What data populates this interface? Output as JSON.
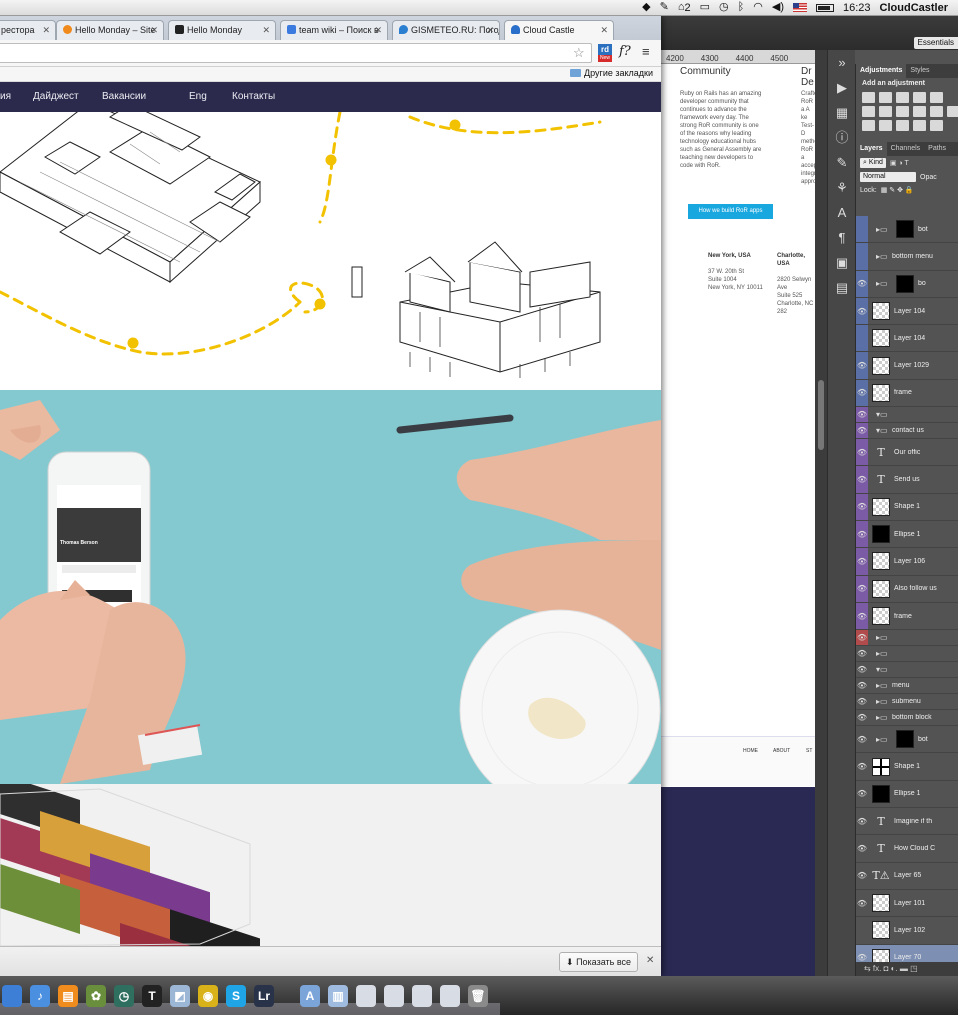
{
  "menubar": {
    "adobe_badge": "2",
    "clock": "16:23",
    "user": "CloudCastler"
  },
  "browser": {
    "tabs": [
      {
        "label": "рестора",
        "favicon_color": "#e07b2a"
      },
      {
        "label": "Hello Monday – Site",
        "favicon_color": "#f08a1c"
      },
      {
        "label": "Hello Monday",
        "favicon_color": "#222222"
      },
      {
        "label": "team wiki – Поиск в",
        "favicon_color": "#3b7be0"
      },
      {
        "label": "GISMETEO.RU: Погод",
        "favicon_color": "#2a7fd0"
      },
      {
        "label": "Cloud Castle",
        "favicon_color": "#2a6fc9"
      }
    ],
    "extension_label": "New",
    "extension_letters": "rd",
    "ext2_label": "f?",
    "bookmarks_other": "Другие закладки",
    "show_all": "Показать все",
    "download_arrow": "⬇"
  },
  "site": {
    "nav": [
      "ия",
      "Дайджест",
      "Вакансии",
      "Eng",
      "Контакты"
    ],
    "phone_name": "Thomas Berson"
  },
  "photoshop": {
    "essentials": "Essentials",
    "ruler": [
      "4200",
      "4300",
      "4400",
      "4500"
    ],
    "doc": {
      "heading_left": "Community",
      "heading_right": "De",
      "heading_right_top": "Dr",
      "paragraph": "Ruby on Rails has an amazing developer community that continues to advance the framework every day. The strong RoR community is one of the reasons why leading technology educational hubs such as General Assembly are teaching new developers to code with RoR.",
      "paragraph_right": "Crafte RoR a A ke Test-D metho RoR a accep integra appro",
      "cta": "How we build RoR apps",
      "addr1_title": "New York, USA",
      "addr1_lines": [
        "37 W. 20th St",
        "Suite 1004",
        "New York, NY 10011"
      ],
      "addr2_title": "Charlotte, USA",
      "addr2_lines": [
        "2820 Selwyn Ave",
        "Suite 525",
        "Charlotte, NC 282"
      ],
      "footer_nav": [
        "HOME",
        "ABOUT",
        "ST"
      ]
    },
    "panel_tabs_top": [
      "Adjustments",
      "Styles"
    ],
    "add_adjustment": "Add an adjustment",
    "panel_tabs_layers": [
      "Layers",
      "Channels",
      "Paths"
    ],
    "kind": "Kind",
    "blend": "Normal",
    "opacity_label": "Opac",
    "lock_label": "Lock:",
    "layers": [
      {
        "name": "bot",
        "kind": "folder-mask",
        "eye": "",
        "color": "blue"
      },
      {
        "name": "bottom menu",
        "kind": "folder",
        "eye": "",
        "color": "blue"
      },
      {
        "name": "bo",
        "kind": "folder-mask",
        "eye": "👁",
        "color": "blue"
      },
      {
        "name": "Layer 104",
        "kind": "image",
        "eye": "👁",
        "color": "blue"
      },
      {
        "name": "Layer 104",
        "kind": "image",
        "eye": "",
        "color": "blue"
      },
      {
        "name": "Layer 1029",
        "kind": "image",
        "eye": "👁",
        "color": "blue"
      },
      {
        "name": "frame",
        "kind": "image",
        "eye": "👁",
        "color": "blue"
      },
      {
        "name": "",
        "kind": "folder-open",
        "eye": "👁",
        "color": "purple",
        "tiny": true
      },
      {
        "name": "contact us",
        "kind": "folder-open",
        "eye": "👁",
        "color": "purple",
        "tiny": true
      },
      {
        "name": "Our offic",
        "kind": "text",
        "eye": "👁",
        "color": "purple"
      },
      {
        "name": "Send us",
        "kind": "text",
        "eye": "👁",
        "color": "purple"
      },
      {
        "name": "Shape 1",
        "kind": "image",
        "eye": "👁",
        "color": "purple"
      },
      {
        "name": "Ellipse 1",
        "kind": "black",
        "eye": "👁",
        "color": "purple"
      },
      {
        "name": "Layer 106",
        "kind": "image",
        "eye": "👁",
        "color": "purple"
      },
      {
        "name": "Also follow us",
        "kind": "image",
        "eye": "👁",
        "color": "purple"
      },
      {
        "name": "frame",
        "kind": "image",
        "eye": "👁",
        "color": "purple"
      },
      {
        "name": "",
        "kind": "folder",
        "eye": "👁",
        "color": "red",
        "tiny": true
      },
      {
        "name": "",
        "kind": "folder",
        "eye": "👁",
        "color": "",
        "tiny": true
      },
      {
        "name": "",
        "kind": "folder-open",
        "eye": "👁",
        "color": "",
        "tiny": true
      },
      {
        "name": "menu",
        "kind": "folder",
        "eye": "👁",
        "color": "",
        "tiny": true
      },
      {
        "name": "submenu",
        "kind": "folder",
        "eye": "👁",
        "color": "",
        "tiny": true
      },
      {
        "name": "bottom block",
        "kind": "folder",
        "eye": "👁",
        "color": "",
        "tiny": true
      },
      {
        "name": "bot",
        "kind": "folder-mask",
        "eye": "👁",
        "color": ""
      },
      {
        "name": "Shape 1",
        "kind": "shape",
        "eye": "👁",
        "color": ""
      },
      {
        "name": "Ellipse 1",
        "kind": "black",
        "eye": "👁",
        "color": ""
      },
      {
        "name": "Imagine if th",
        "kind": "text",
        "eye": "👁",
        "color": ""
      },
      {
        "name": "How Cloud C",
        "kind": "text",
        "eye": "👁",
        "color": ""
      },
      {
        "name": "Layer 65",
        "kind": "text-warn",
        "eye": "👁",
        "color": ""
      },
      {
        "name": "Layer 101",
        "kind": "image",
        "eye": "👁",
        "color": ""
      },
      {
        "name": "Layer 102",
        "kind": "image",
        "eye": "",
        "color": ""
      },
      {
        "name": "Layer 70",
        "kind": "image",
        "eye": "👁",
        "color": "",
        "selected": true
      }
    ],
    "panel_footer": "⇆  fx.  ◘  ◐.  ▬  ◳"
  },
  "dock": {
    "icons": [
      {
        "name": "finder",
        "label": "",
        "color": "#3d7fd6"
      },
      {
        "name": "itunes",
        "label": "♪",
        "color": "#4a8fe0"
      },
      {
        "name": "ibooks",
        "label": "▤",
        "color": "#f08b1e"
      },
      {
        "name": "iphoto",
        "label": "✿",
        "color": "#6a8f3c"
      },
      {
        "name": "time-machine",
        "label": "◷",
        "color": "#2f6f5f"
      },
      {
        "name": "typora",
        "label": "T",
        "color": "#222222"
      },
      {
        "name": "preview",
        "label": "◩",
        "color": "#9cb6d6"
      },
      {
        "name": "chrome",
        "label": "◉",
        "color": "#d9b21a"
      },
      {
        "name": "skype",
        "label": "S",
        "color": "#1fa5e6"
      },
      {
        "name": "lightroom",
        "label": "Lr",
        "color": "#28334a"
      },
      {
        "name": "app-folder",
        "label": "A",
        "color": "#7ba4d9"
      },
      {
        "name": "docs-folder",
        "label": "▥",
        "color": "#9fbbe0"
      },
      {
        "name": "screenshot-1",
        "label": "",
        "color": "#d8dce4"
      },
      {
        "name": "screenshot-2",
        "label": "",
        "color": "#d8dce4"
      },
      {
        "name": "screenshot-3",
        "label": "",
        "color": "#d8dce4"
      },
      {
        "name": "screenshot-4",
        "label": "",
        "color": "#d8dce4"
      },
      {
        "name": "trash",
        "label": "🗑",
        "color": "#8a8a8a"
      }
    ]
  }
}
